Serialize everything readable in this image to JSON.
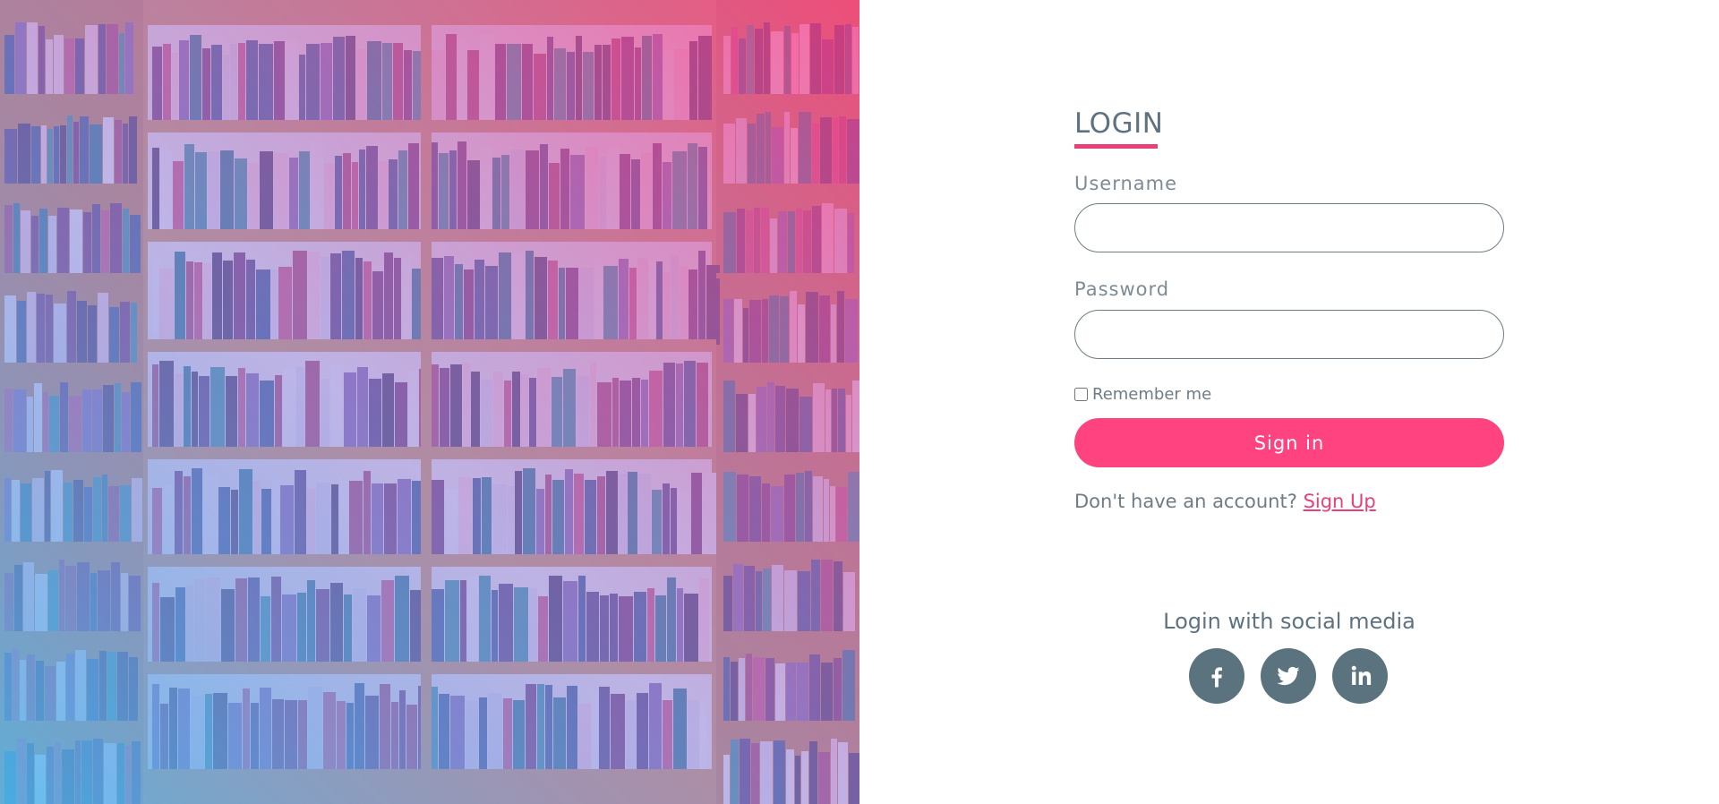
{
  "login": {
    "title": "LOGIN",
    "username_label": "Username",
    "username_value": "",
    "password_label": "Password",
    "password_value": "",
    "remember_label": "Remember me",
    "remember_checked": false,
    "signin_label": "Sign in",
    "no_account_text": "Don't have an account?",
    "signup_link": "Sign Up"
  },
  "social": {
    "title": "Login with social media",
    "buttons": [
      {
        "icon": "facebook-icon"
      },
      {
        "icon": "twitter-icon"
      },
      {
        "icon": "linkedin-icon"
      }
    ]
  },
  "colors": {
    "accent": "#ff4381",
    "underline": "#e8407a",
    "text": "#6f7c85",
    "social_bg": "#5b737f"
  },
  "images": {
    "hero": "bookshelf photo with pink-to-blue gradient overlay"
  }
}
